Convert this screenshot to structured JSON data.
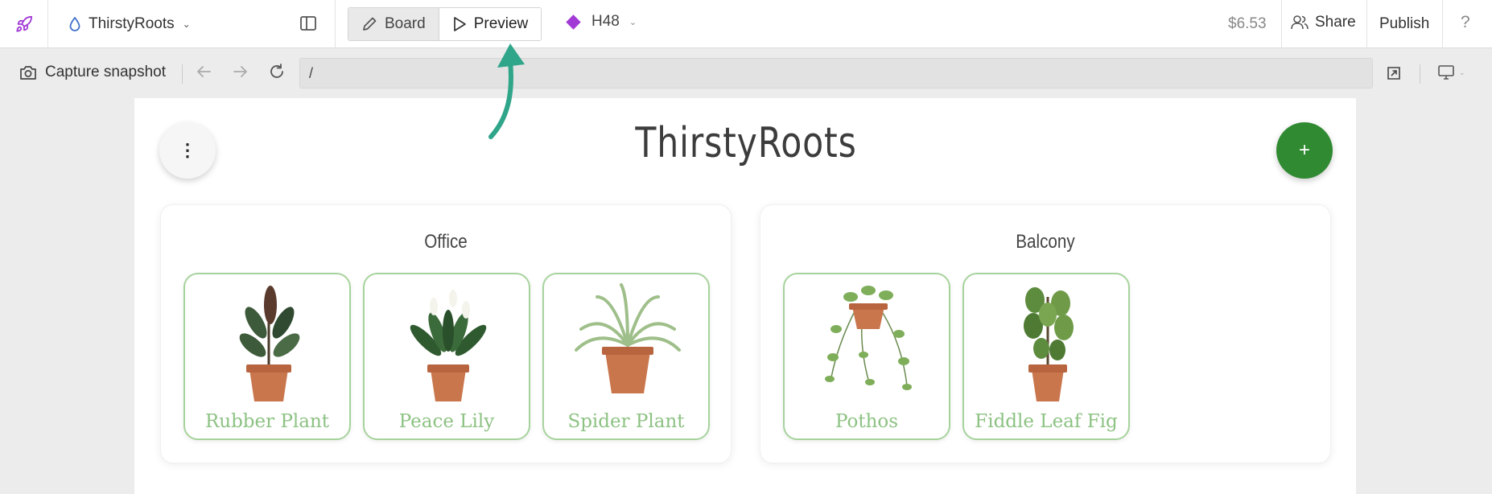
{
  "header": {
    "project_name": "ThirstyRoots",
    "tabs": [
      {
        "label": "Board"
      },
      {
        "label": "Preview"
      }
    ],
    "branch": "H48",
    "price": "$6.53",
    "share_label": "Share",
    "publish_label": "Publish",
    "help_label": "?"
  },
  "toolbar": {
    "snapshot_label": "Capture snapshot",
    "url": "/"
  },
  "app": {
    "title": "ThirstyRoots",
    "menu_icon": "⋮",
    "add_icon": "+",
    "groups": [
      {
        "name": "Office",
        "plants": [
          {
            "name": "Rubber Plant"
          },
          {
            "name": "Peace Lily"
          },
          {
            "name": "Spider Plant"
          }
        ]
      },
      {
        "name": "Balcony",
        "plants": [
          {
            "name": "Pothos"
          },
          {
            "name": "Fiddle Leaf Fig"
          }
        ]
      }
    ]
  },
  "colors": {
    "accent_green": "#2f8a31",
    "card_border": "#a6d39c",
    "card_label": "#8dc283",
    "annotation_arrow": "#2fa58a",
    "branch_diamond": "#a23bd6"
  },
  "icons": [
    "rocket-icon",
    "droplet-icon",
    "split-view-icon",
    "pencil-icon",
    "play-icon",
    "diamond-icon",
    "users-icon",
    "camera-icon",
    "back-arrow-icon",
    "forward-arrow-icon",
    "reload-icon",
    "open-external-icon",
    "monitor-icon"
  ]
}
